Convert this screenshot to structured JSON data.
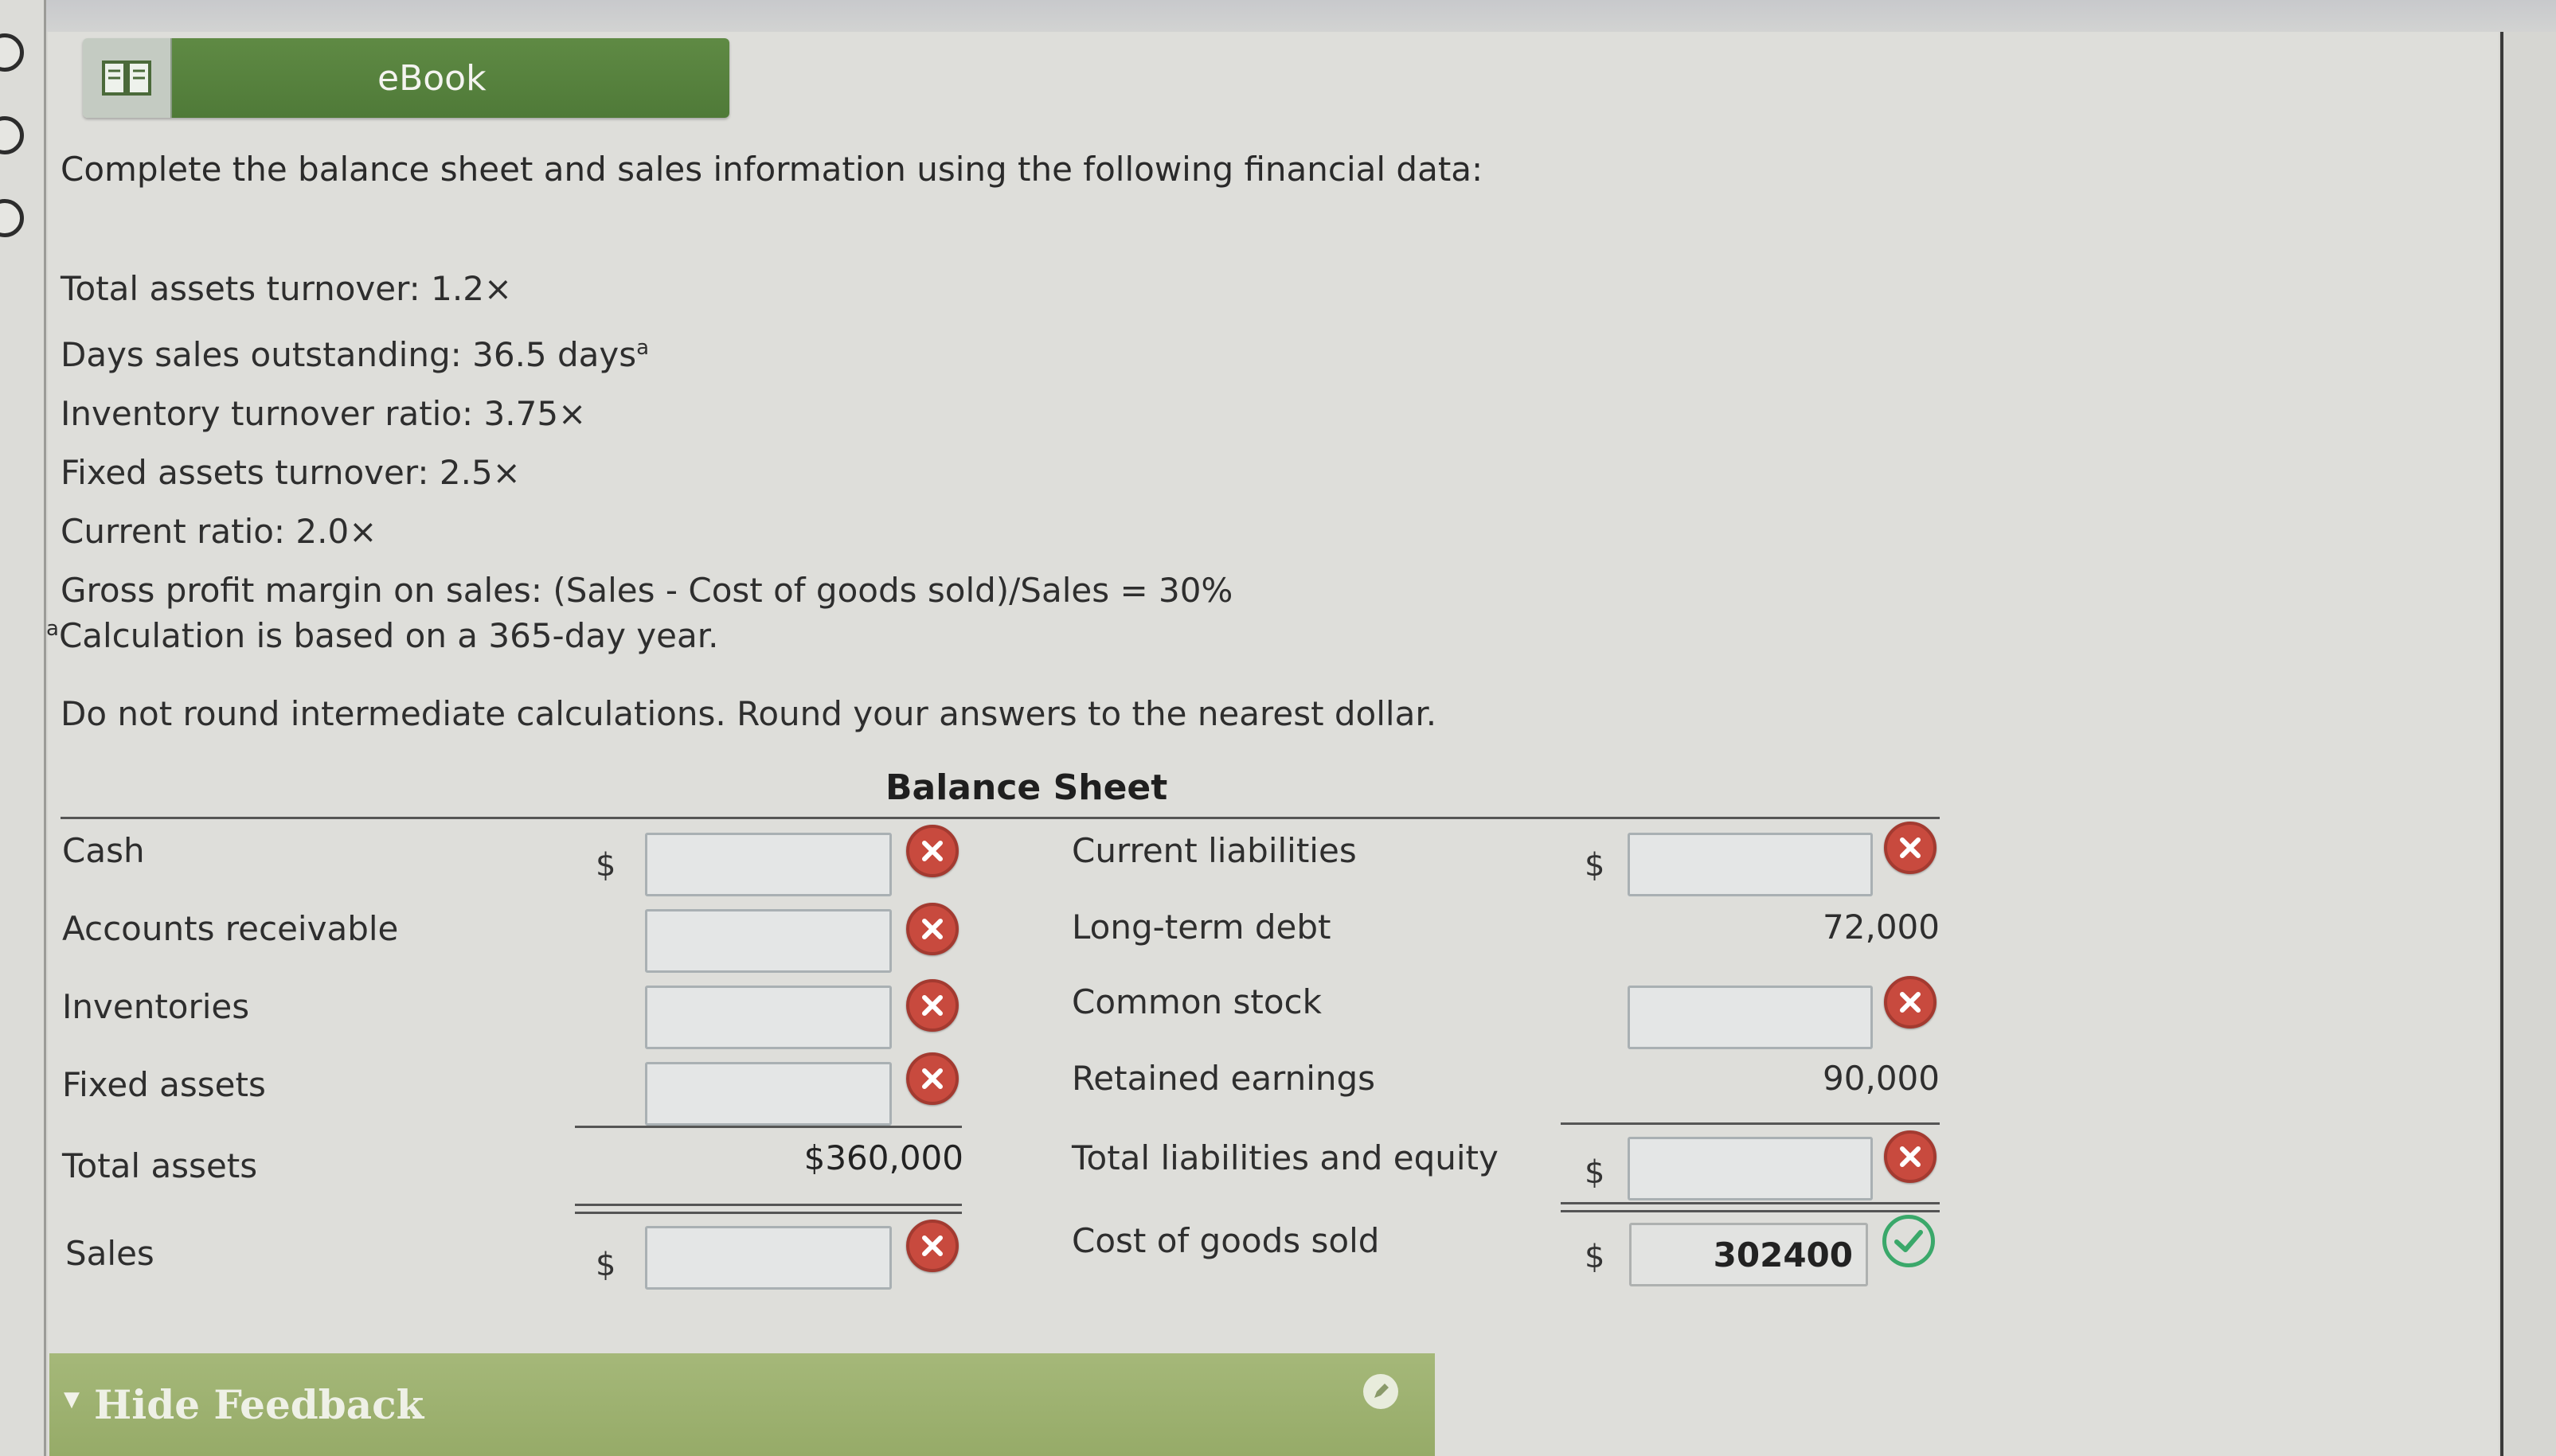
{
  "ebook": {
    "label": "eBook"
  },
  "intro": "Complete the balance sheet and sales information using the following financial data:",
  "given": [
    "Total assets turnover: 1.2×",
    "Days sales outstanding: 36.5 days",
    "Inventory turnover ratio: 3.75×",
    "Fixed assets turnover: 2.5×",
    "Current ratio: 2.0×",
    "Gross profit margin on sales: (Sales - Cost of goods sold)/Sales = 30%"
  ],
  "given_sup": "a",
  "footnote": {
    "sup": "a",
    "text": "Calculation is based on a 365-day year."
  },
  "instructions": "Do not round intermediate calculations. Round your answers to the nearest dollar.",
  "balance_sheet": {
    "title": "Balance Sheet",
    "currency": "$",
    "left": {
      "cash": "Cash",
      "accounts_receivable": "Accounts receivable",
      "inventories": "Inventories",
      "fixed_assets": "Fixed assets",
      "total_assets": "Total assets",
      "total_assets_value": "$360,000",
      "sales": "Sales"
    },
    "right": {
      "current_liabilities": "Current liabilities",
      "long_term_debt": "Long-term debt",
      "long_term_debt_value": "72,000",
      "common_stock": "Common stock",
      "retained_earnings": "Retained earnings",
      "retained_earnings_value": "90,000",
      "total_liabilities_equity": "Total liabilities and equity",
      "cogs": "Cost of goods sold",
      "cogs_value": "302400"
    }
  },
  "feedback": {
    "label": "Hide Feedback"
  },
  "colors": {
    "ebook_green": "#5f8a44",
    "incorrect_red": "#c84a3e",
    "correct_green": "#3aa86a",
    "feedback_bar": "#a5b879"
  }
}
